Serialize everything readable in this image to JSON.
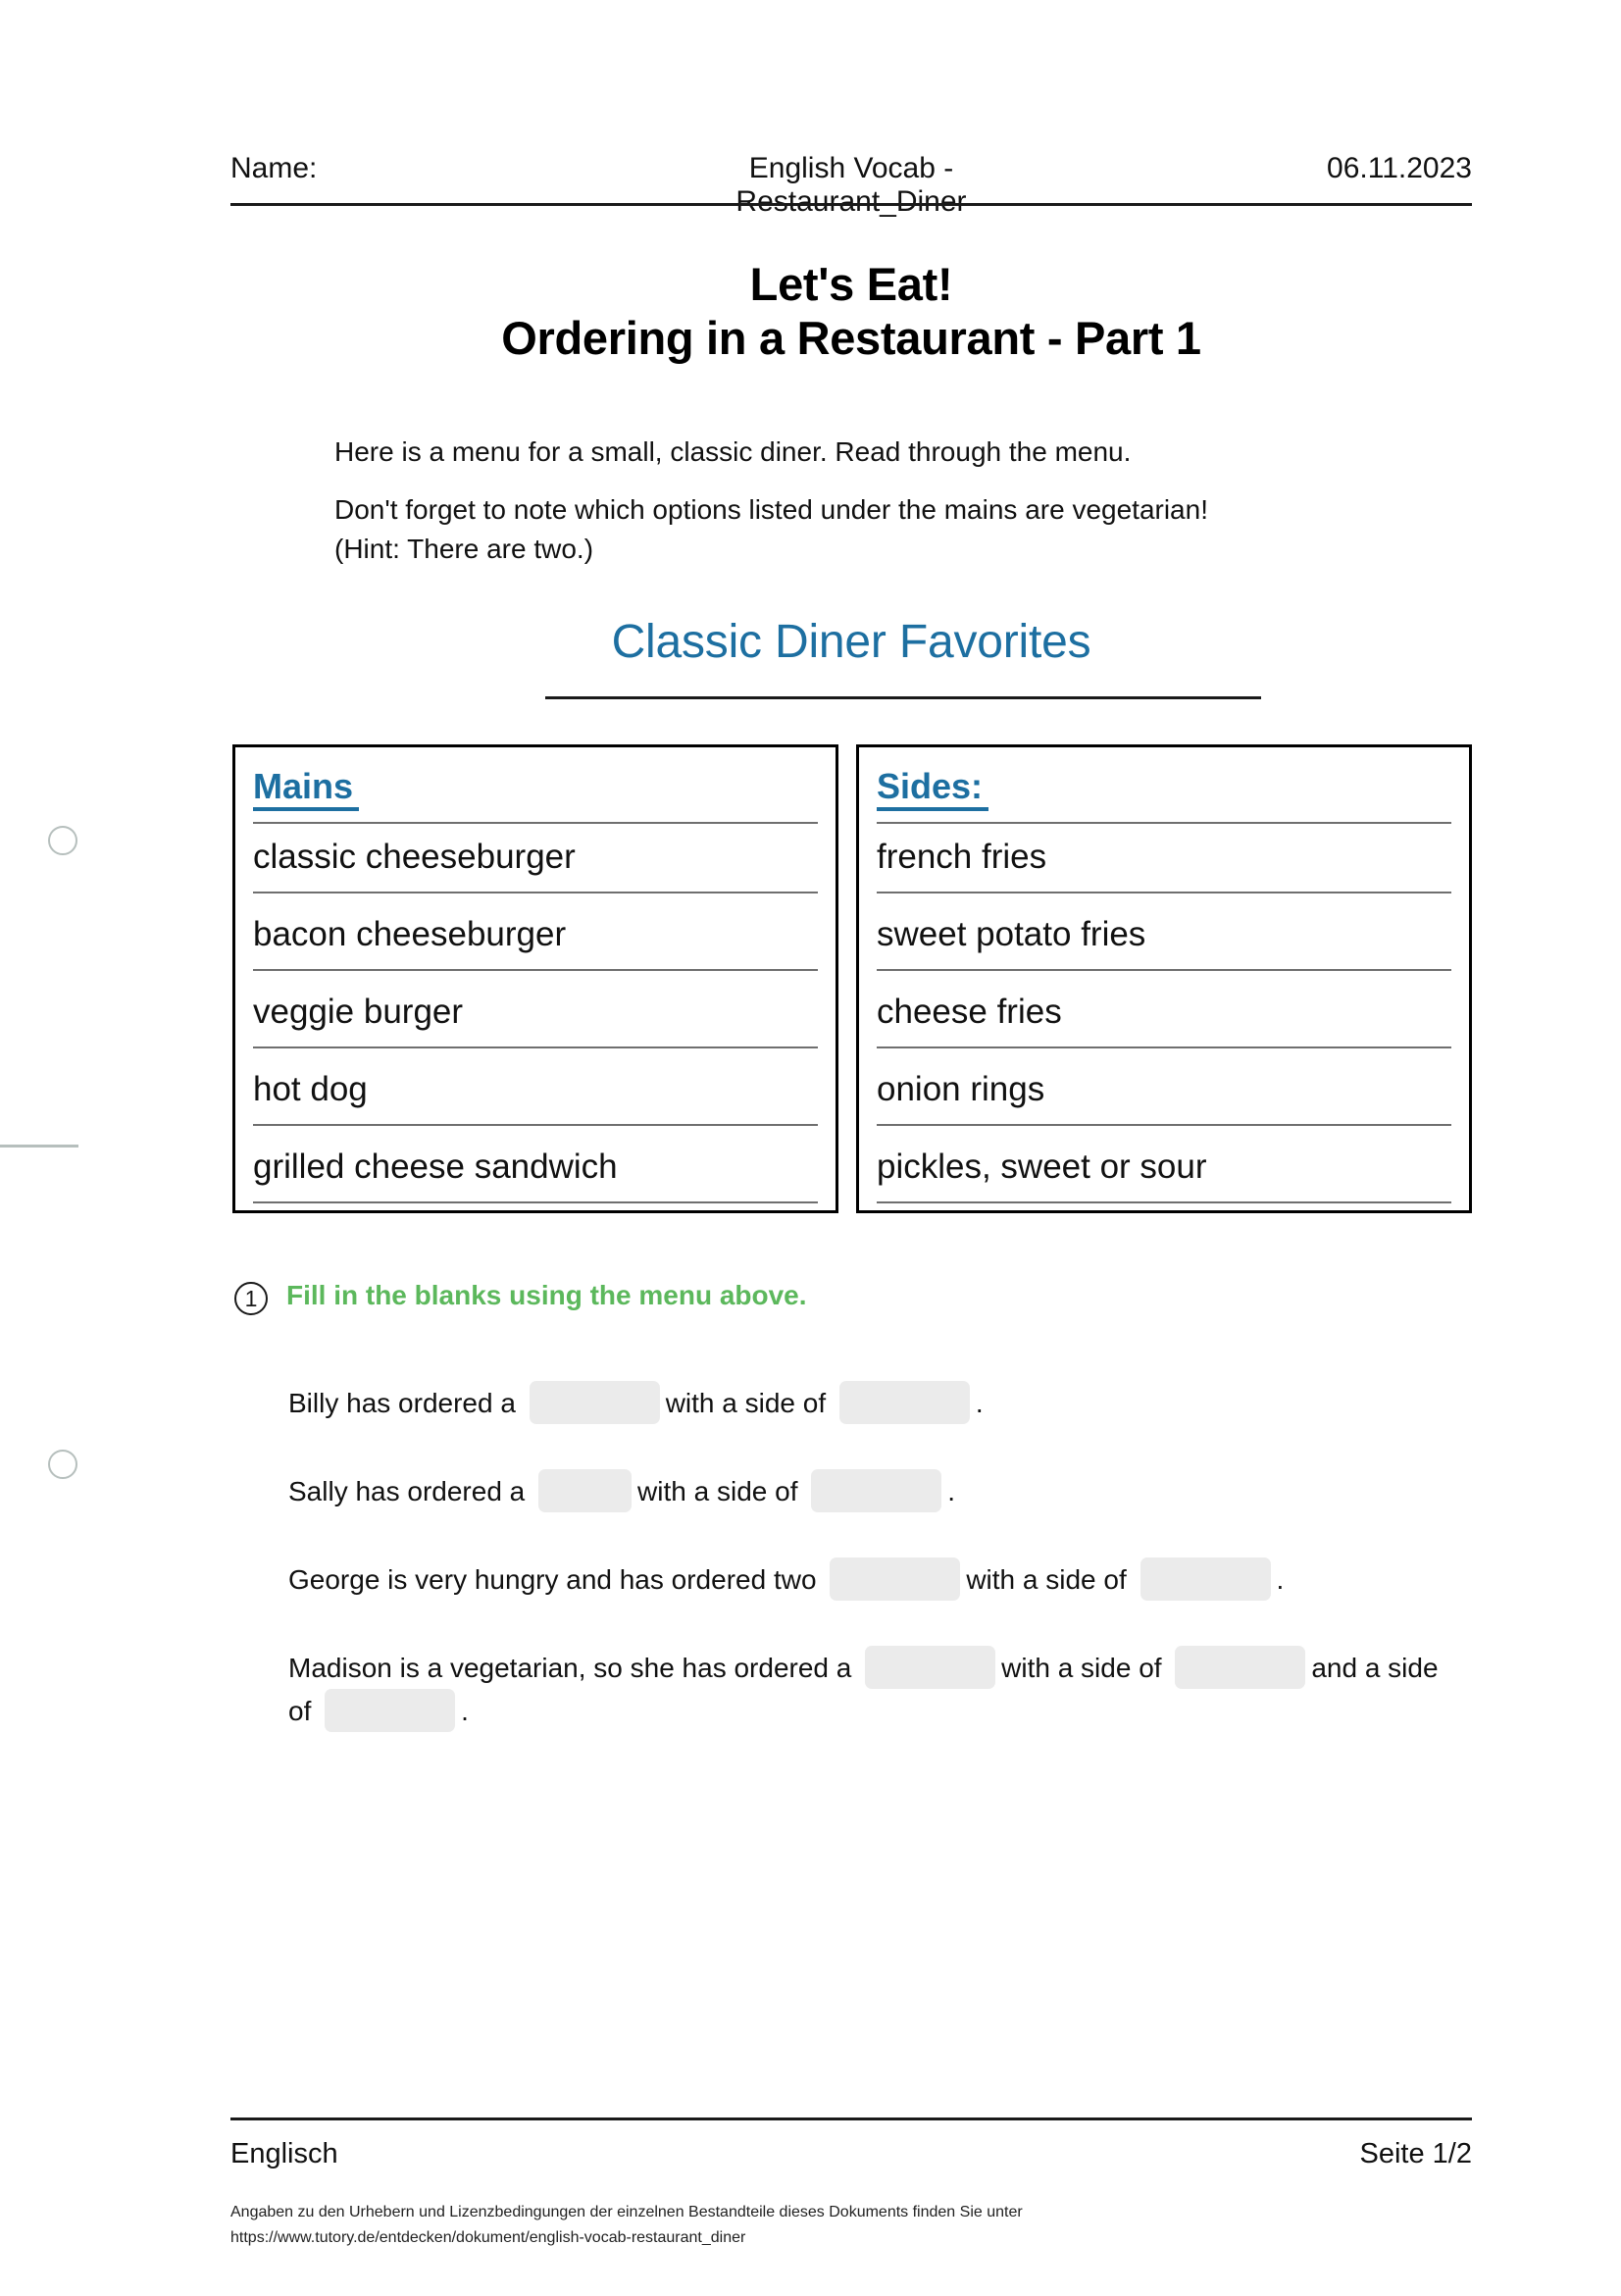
{
  "header": {
    "name_label": "Name:",
    "document_title": "English Vocab - Restaurant_Diner",
    "date": "06.11.2023"
  },
  "title": {
    "line1": "Let's Eat!",
    "line2": "Ordering in a Restaurant - Part 1"
  },
  "intro": {
    "paragraph1": "Here is a menu for a small, classic diner. Read through the menu.",
    "paragraph2": "Don't forget to note which options listed under the mains are vegetarian!",
    "paragraph3": "(Hint: There are two.)"
  },
  "menu": {
    "heading": "Classic Diner Favorites",
    "accent_color": "#1d6fa1",
    "columns": [
      {
        "title": "Mains",
        "items": [
          "classic cheeseburger",
          "bacon cheeseburger",
          "veggie burger",
          "hot dog",
          "grilled cheese sandwich"
        ]
      },
      {
        "title": "Sides:",
        "items": [
          "french fries",
          "sweet potato fries",
          "cheese fries",
          "onion rings",
          "pickles, sweet or sour"
        ]
      }
    ]
  },
  "exercise": {
    "number": "1",
    "instruction": "Fill in the blanks using the menu above.",
    "instruction_color": "#5cb85c",
    "blank_color": "#ebebeb",
    "sentences": [
      {
        "id": "billy",
        "parts": [
          {
            "type": "text",
            "value": "Billy has ordered a"
          },
          {
            "type": "blank",
            "width": 133
          },
          {
            "type": "text",
            "value": "with a side of"
          },
          {
            "type": "blank",
            "width": 133
          },
          {
            "type": "text",
            "value": "."
          }
        ]
      },
      {
        "id": "sally",
        "parts": [
          {
            "type": "text",
            "value": "Sally has ordered a"
          },
          {
            "type": "blank",
            "width": 95
          },
          {
            "type": "text",
            "value": "with a side of"
          },
          {
            "type": "blank",
            "width": 133
          },
          {
            "type": "text",
            "value": "."
          }
        ]
      },
      {
        "id": "george",
        "parts": [
          {
            "type": "text",
            "value": "George is very hungry and has ordered two"
          },
          {
            "type": "blank",
            "width": 133
          },
          {
            "type": "text",
            "value": "with a side of"
          },
          {
            "type": "blank",
            "width": 133
          },
          {
            "type": "text",
            "value": "."
          }
        ]
      },
      {
        "id": "madison",
        "parts": [
          {
            "type": "text",
            "value": "Madison is a vegetarian, so she has ordered a"
          },
          {
            "type": "blank",
            "width": 133
          },
          {
            "type": "text",
            "value": "with a side of"
          },
          {
            "type": "blank",
            "width": 133
          },
          {
            "type": "text",
            "value": "and a side of"
          },
          {
            "type": "blank",
            "width": 133
          },
          {
            "type": "text",
            "value": "."
          }
        ]
      }
    ]
  },
  "footer": {
    "subject": "Englisch",
    "page": "Seite 1/2",
    "credits_line1": "Angaben zu den Urhebern und Lizenzbedingungen der einzelnen Bestandteile dieses Dokuments finden Sie unter",
    "credits_line2": "https://www.tutory.de/entdecken/dokument/english-vocab-restaurant_diner"
  }
}
